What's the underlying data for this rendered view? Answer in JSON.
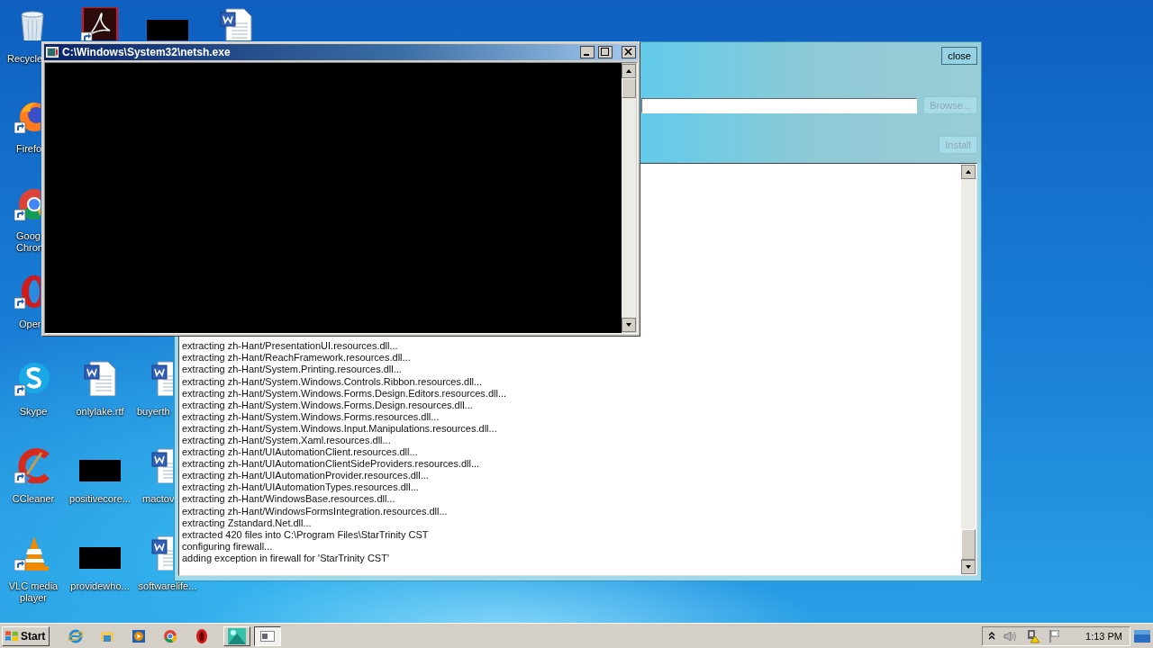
{
  "desktop_icons": [
    {
      "kind": "recycle-bin",
      "label": "Recycle",
      "shortcut": false
    },
    {
      "kind": "pdf",
      "shortcut": true
    },
    {
      "kind": "thumbnail",
      "shortcut": false
    },
    {
      "kind": "document",
      "shortcut": false
    },
    {
      "kind": "firefox",
      "label": "Firefo",
      "shortcut": true
    },
    {
      "kind": "chrome",
      "label": "Goog Chron",
      "shortcut": true
    },
    {
      "kind": "opera",
      "label": "Oper",
      "shortcut": true
    },
    {
      "kind": "skype",
      "label": "Skype",
      "shortcut": true
    },
    {
      "kind": "document",
      "label": "onlylake.rtf",
      "shortcut": false
    },
    {
      "kind": "document",
      "label": "buyerth",
      "shortcut": false
    },
    {
      "kind": "ccleaner",
      "label": "CCleaner",
      "shortcut": true
    },
    {
      "kind": "thumbnail",
      "label": "positivecore...",
      "shortcut": false
    },
    {
      "kind": "document",
      "label": "mactov",
      "shortcut": false
    },
    {
      "kind": "vlc",
      "label": "VLC media player",
      "shortcut": true
    },
    {
      "kind": "thumbnail",
      "label": "providewho...",
      "shortcut": false
    },
    {
      "kind": "document",
      "label": "softwarelife...",
      "shortcut": false
    }
  ],
  "installer": {
    "buttons": [
      {
        "label": "close",
        "disabled": false
      },
      {
        "label": "Browse...",
        "disabled": true
      },
      {
        "label": "Install",
        "disabled": true
      }
    ],
    "log": [
      "extracting zh-Hant/PresentationUI.resources.dll...",
      "extracting zh-Hant/ReachFramework.resources.dll...",
      "extracting zh-Hant/System.Printing.resources.dll...",
      "extracting zh-Hant/System.Windows.Controls.Ribbon.resources.dll...",
      "extracting zh-Hant/System.Windows.Forms.Design.Editors.resources.dll...",
      "extracting zh-Hant/System.Windows.Forms.Design.resources.dll...",
      "extracting zh-Hant/System.Windows.Forms.resources.dll...",
      "extracting zh-Hant/System.Windows.Input.Manipulations.resources.dll...",
      "extracting zh-Hant/System.Xaml.resources.dll...",
      "extracting zh-Hant/UIAutomationClient.resources.dll...",
      "extracting zh-Hant/UIAutomationClientSideProviders.resources.dll...",
      "extracting zh-Hant/UIAutomationProvider.resources.dll...",
      "extracting zh-Hant/UIAutomationTypes.resources.dll...",
      "extracting zh-Hant/WindowsBase.resources.dll...",
      "extracting zh-Hant/WindowsFormsIntegration.resources.dll...",
      "extracting Zstandard.Net.dll...",
      "extracted 420 files into C:\\Program Files\\StarTrinity CST",
      "configuring firewall...",
      "adding exception in firewall for 'StarTrinity CST'"
    ]
  },
  "console_window": {
    "title": "C:\\Windows\\System32\\netsh.exe"
  },
  "taskbar": {
    "start": "Start",
    "quick_launch": [
      {
        "kind": "ie"
      },
      {
        "kind": "explorer"
      },
      {
        "kind": "media-player"
      },
      {
        "kind": "chrome"
      },
      {
        "kind": "opera"
      }
    ],
    "tasks": [
      {
        "kind": "app",
        "selected": false
      },
      {
        "kind": "console",
        "selected": true
      }
    ],
    "tray": [
      {
        "kind": "show-hidden"
      },
      {
        "kind": "speaker"
      },
      {
        "kind": "network-warning"
      },
      {
        "kind": "flag"
      }
    ],
    "clock": "1:13 PM"
  }
}
